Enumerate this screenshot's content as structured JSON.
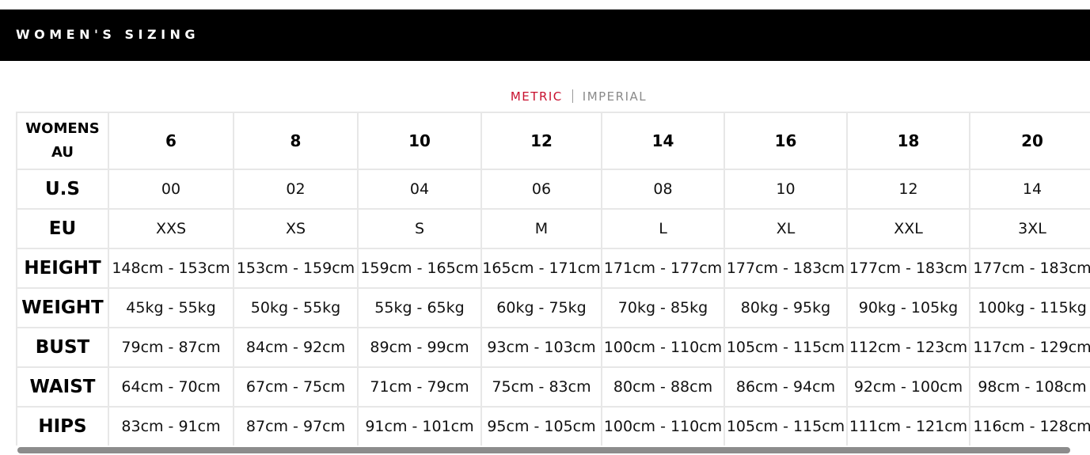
{
  "header": {
    "title": "WOMEN'S SIZING"
  },
  "unit_toggle": {
    "options": [
      "METRIC",
      "IMPERIAL"
    ],
    "selected": "METRIC",
    "active_color": "#c8102e"
  },
  "size_table": {
    "header_row": {
      "label": "WOMENS AU",
      "columns": [
        "6",
        "8",
        "10",
        "12",
        "14",
        "16",
        "18",
        "20"
      ]
    },
    "rows": [
      {
        "label": "U.S",
        "cells": [
          "00",
          "02",
          "04",
          "06",
          "08",
          "10",
          "12",
          "14"
        ]
      },
      {
        "label": "EU",
        "cells": [
          "XXS",
          "XS",
          "S",
          "M",
          "L",
          "XL",
          "XXL",
          "3XL"
        ]
      },
      {
        "label": "HEIGHT",
        "cells": [
          "148cm - 153cm",
          "153cm - 159cm",
          "159cm - 165cm",
          "165cm - 171cm",
          "171cm - 177cm",
          "177cm - 183cm",
          "177cm - 183cm",
          "177cm - 183cm"
        ]
      },
      {
        "label": "WEIGHT",
        "cells": [
          "45kg - 55kg",
          "50kg - 55kg",
          "55kg - 65kg",
          "60kg - 75kg",
          "70kg - 85kg",
          "80kg - 95kg",
          "90kg - 105kg",
          "100kg - 115kg"
        ]
      },
      {
        "label": "BUST",
        "cells": [
          "79cm - 87cm",
          "84cm - 92cm",
          "89cm - 99cm",
          "93cm - 103cm",
          "100cm - 110cm",
          "105cm - 115cm",
          "112cm - 123cm",
          "117cm - 129cm"
        ]
      },
      {
        "label": "WAIST",
        "cells": [
          "64cm - 70cm",
          "67cm - 75cm",
          "71cm - 79cm",
          "75cm - 83cm",
          "80cm - 88cm",
          "86cm - 94cm",
          "92cm - 100cm",
          "98cm - 108cm"
        ]
      },
      {
        "label": "HIPS",
        "cells": [
          "83cm - 91cm",
          "87cm - 97cm",
          "91cm - 101cm",
          "95cm - 105cm",
          "100cm - 110cm",
          "105cm - 115cm",
          "111cm - 121cm",
          "116cm - 128cm"
        ]
      }
    ]
  }
}
